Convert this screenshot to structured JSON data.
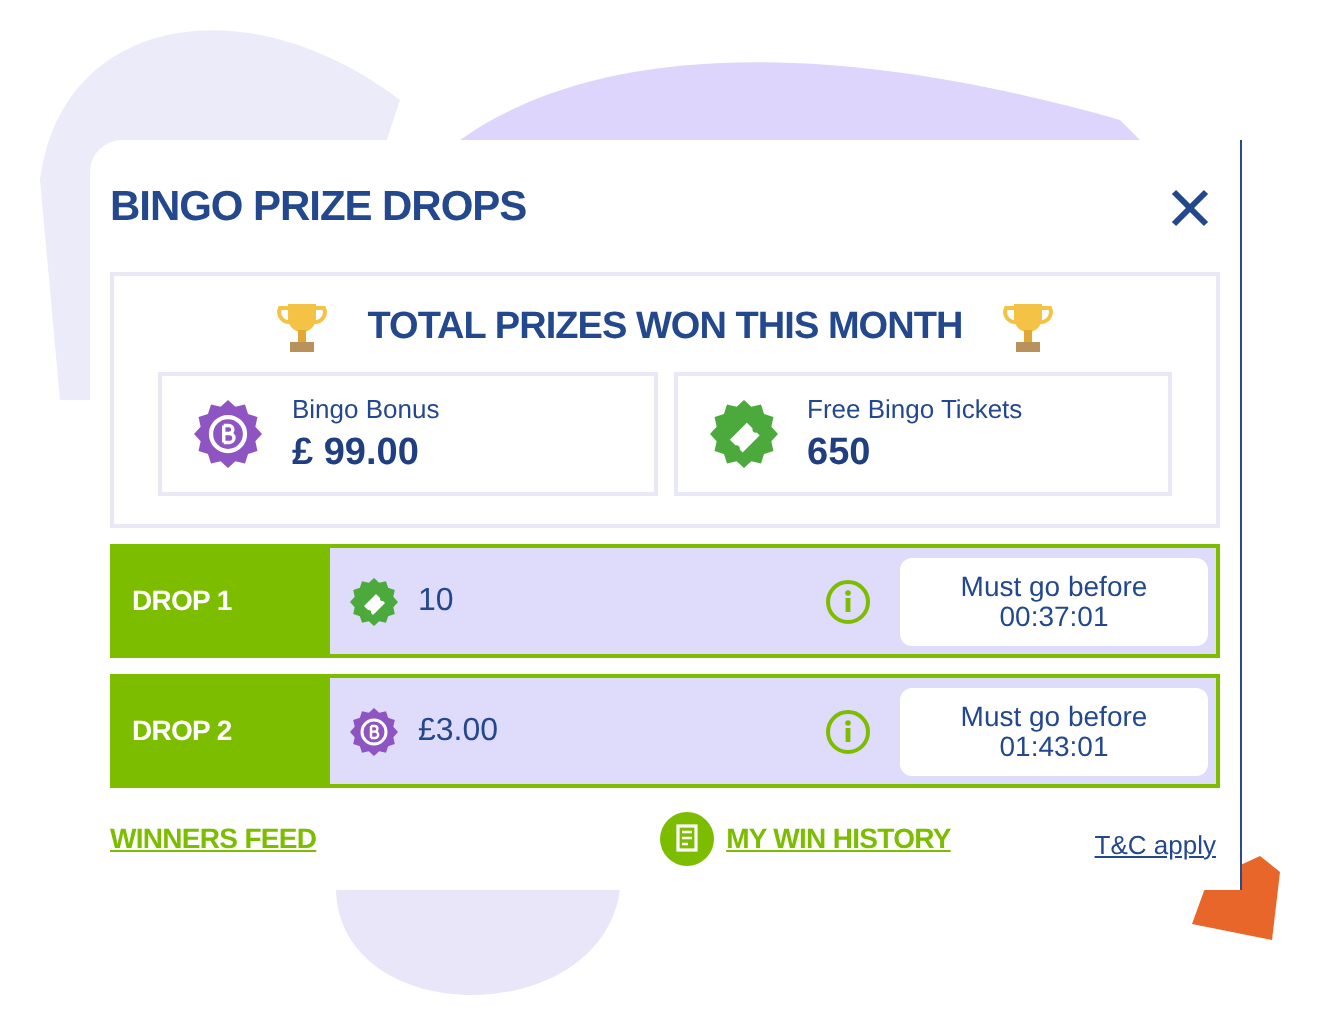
{
  "title": "BINGO PRIZE DROPS",
  "totals": {
    "heading": "TOTAL PRIZES WON THIS MONTH",
    "items": [
      {
        "kind": "bonus",
        "label": "Bingo Bonus",
        "value": "£ 99.00"
      },
      {
        "kind": "tickets",
        "label": "Free Bingo Tickets",
        "value": "650"
      }
    ]
  },
  "drops": [
    {
      "name": "DROP 1",
      "kind": "tickets",
      "amount": "10",
      "deadline_label": "Must go before",
      "deadline": "00:37:01"
    },
    {
      "name": "DROP 2",
      "kind": "bonus",
      "amount": "£3.00",
      "deadline_label": "Must go before",
      "deadline": "01:43:01"
    }
  ],
  "footer": {
    "winners_feed": "WINNERS FEED",
    "history": "MY WIN HISTORY",
    "terms": "T&C apply"
  }
}
